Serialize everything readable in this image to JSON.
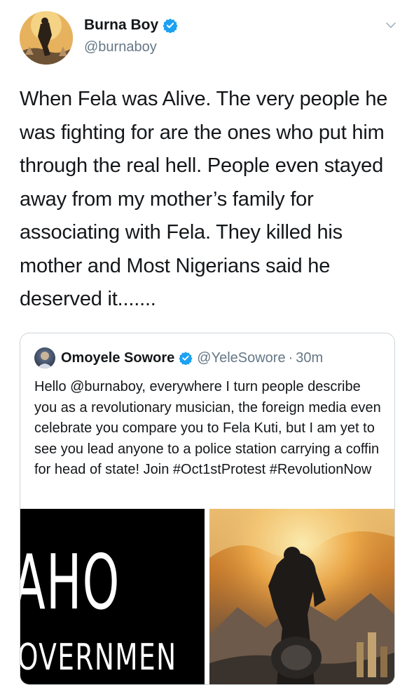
{
  "tweet": {
    "author": {
      "display_name": "Burna Boy",
      "handle": "@burnaboy",
      "avatar_icon": "artist-avatar",
      "verified_icon": "verified-badge-icon"
    },
    "text": "When Fela was Alive. The very people he was fighting for are the ones who put him through the real hell. People even stayed away from my mother’s family for associating with Fela. They killed his mother and Most Nigerians said he deserved it.......",
    "menu_icon": "chevron-down-icon"
  },
  "quoted_tweet": {
    "author": {
      "display_name": "Omoyele Sowore",
      "handle": "@YeleSowore",
      "separator": "·",
      "time": "30m"
    },
    "text": "Hello @burnaboy, everywhere I turn people describe you as a revolutionary musician, the foreign media even celebrate you compare you to Fela Kuti, but I am yet to see you lead anyone to a police station carrying a coffin for head of state! Join #Oct1stProtest #RevolutionNow",
    "media": {
      "left_image_big_text": "AHO",
      "left_image_small_text": "OVERNMEN"
    }
  },
  "colors": {
    "text_primary": "#14171a",
    "text_secondary": "#657786",
    "verified_blue": "#1da1f2",
    "border": "#ccd6dd"
  }
}
